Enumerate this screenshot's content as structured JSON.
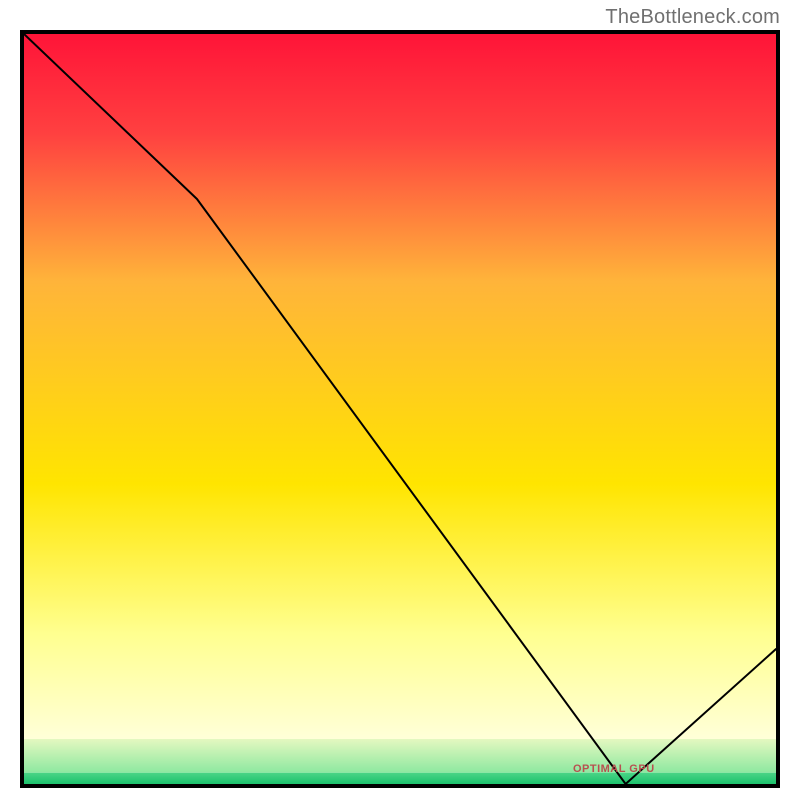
{
  "watermark": "TheBottleneck.com",
  "optimal_label": "OPTIMAL GPU",
  "chart_data": {
    "type": "line",
    "title": "",
    "xlabel": "",
    "ylabel": "",
    "x": [
      0,
      23,
      80,
      100
    ],
    "y": [
      100,
      78,
      0,
      18
    ],
    "ylim": [
      0,
      100
    ],
    "xlim": [
      0,
      100
    ],
    "gradient_bands": [
      {
        "from": 0.0,
        "to": 0.6,
        "top": "#ff1a3a",
        "bot": "#ffe500"
      },
      {
        "from": 0.6,
        "to": 0.8,
        "top": "#ffe500",
        "bot": "#ffff9a"
      },
      {
        "from": 0.8,
        "to": 0.94,
        "top": "#ffff9a",
        "bot": "#ffffd8"
      },
      {
        "from": 0.94,
        "to": 0.985,
        "top": "#d8f5a8",
        "bot": "#7de59a"
      },
      {
        "from": 0.985,
        "to": 1.0,
        "top": "#2fd47a",
        "bot": "#1cc26c"
      }
    ],
    "optimal_x_fraction": 0.8
  }
}
